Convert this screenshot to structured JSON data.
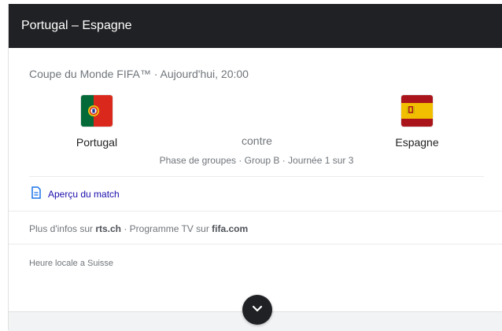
{
  "header": {
    "title": "Portugal – Espagne"
  },
  "match": {
    "competition": "Coupe du Monde FIFA™ · Aujourd'hui, 20:00",
    "home": {
      "name": "Portugal",
      "flag": "portugal-flag"
    },
    "away": {
      "name": "Espagne",
      "flag": "spain-flag"
    },
    "vs_label": "contre",
    "phase": "Phase de groupes · Group B · Journée 1 sur 3"
  },
  "preview": {
    "label": "Aperçu du match",
    "icon": "document-icon"
  },
  "more_info": {
    "prefix": "Plus d'infos sur ",
    "source1": "rts.ch",
    "middle": " · Programme TV sur ",
    "source2": "fifa.com"
  },
  "timezone_note": "Heure locale a Suisse",
  "expand": {
    "icon": "chevron-down-icon"
  },
  "colors": {
    "header_bg": "#202124",
    "link": "#1a0dab",
    "muted_text": "#70757a",
    "portugal_green": "#046a38",
    "portugal_red": "#da291c",
    "spain_red": "#aa151b",
    "spain_yellow": "#f1bf00"
  }
}
